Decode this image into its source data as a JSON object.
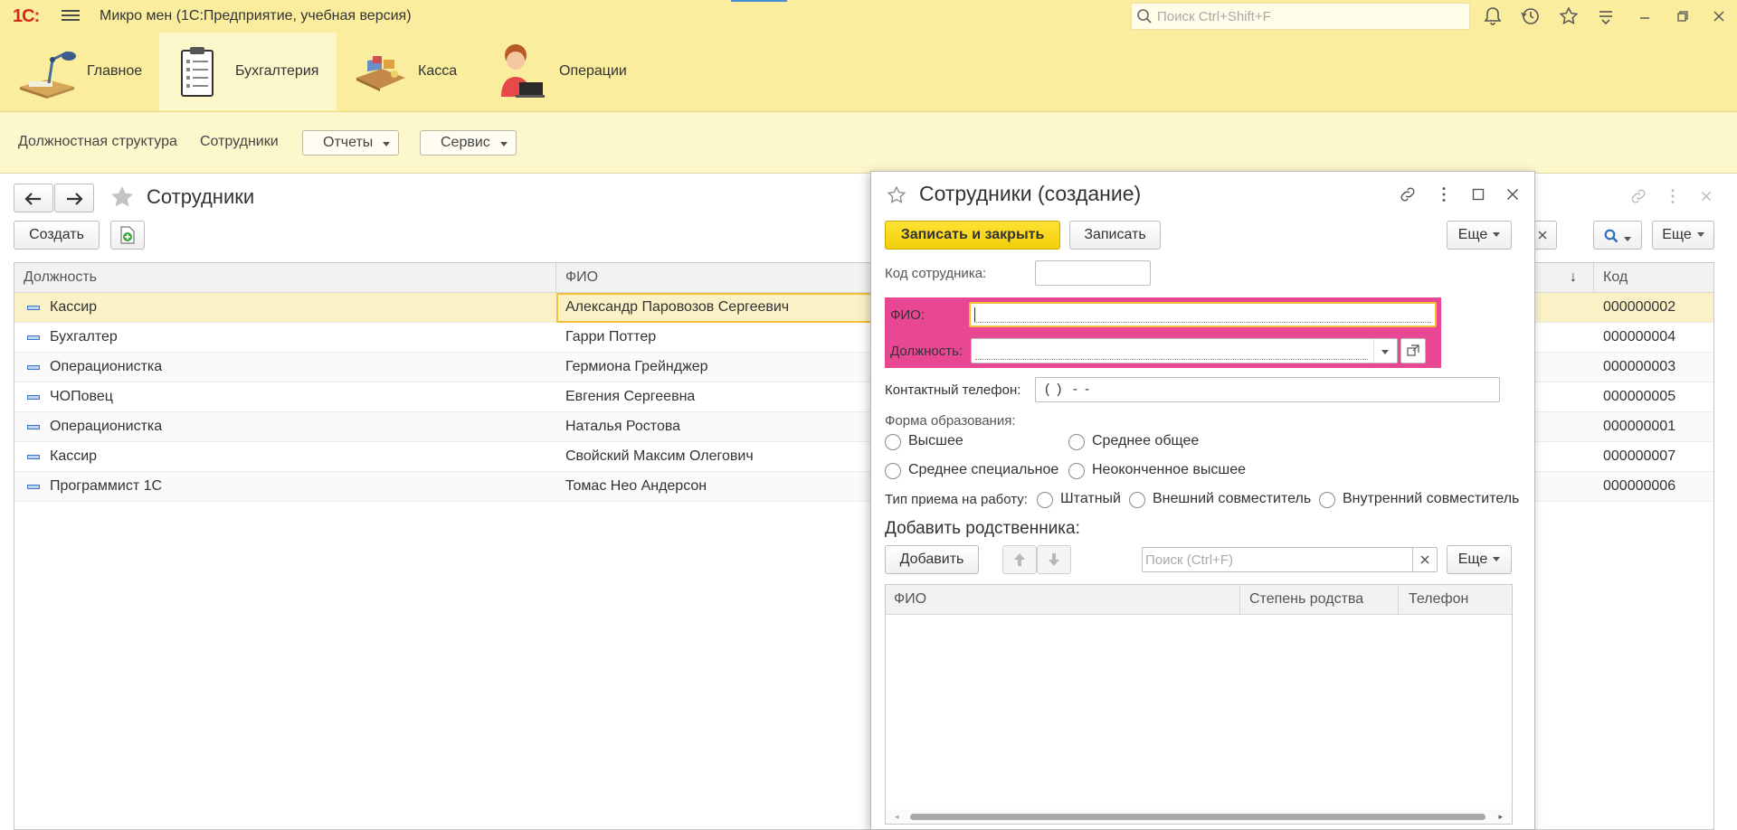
{
  "app": {
    "logo": "1С:",
    "title": "Микро мен  (1С:Предприятие, учебная версия)",
    "search_placeholder": "Поиск Ctrl+Shift+F"
  },
  "sections": [
    {
      "label": "Главное"
    },
    {
      "label": "Бухгалтерия"
    },
    {
      "label": "Касса"
    },
    {
      "label": "Операции"
    }
  ],
  "nav": {
    "links": [
      "Должностная структура",
      "Сотрудники"
    ],
    "reports_label": "Отчеты",
    "service_label": "Сервис"
  },
  "list": {
    "title": "Сотрудники",
    "create_label": "Создать",
    "more_label": "Еще",
    "columns": {
      "position": "Должность",
      "fio": "ФИО",
      "code": "Код",
      "sort_indicator": "↓"
    },
    "rows": [
      {
        "position": "Кассир",
        "fio": "Александр Паровозов Сергеевич",
        "code": "000000002"
      },
      {
        "position": "Бухгалтер",
        "fio": "Гарри Поттер",
        "code": "000000004"
      },
      {
        "position": "Операционистка",
        "fio": "Гермиона Грейнджер",
        "code": "000000003"
      },
      {
        "position": "ЧОПовец",
        "fio": "Евгения Сергеевна",
        "code": "000000005"
      },
      {
        "position": "Операционистка",
        "fio": "Наталья Ростова",
        "code": "000000001"
      },
      {
        "position": "Кассир",
        "fio": "Свойский Максим Олегович",
        "code": "000000007"
      },
      {
        "position": "Программист 1С",
        "fio": "Томас Нео Андерсон",
        "code": "000000006"
      }
    ]
  },
  "dialog": {
    "title": "Сотрудники (создание)",
    "save_close_label": "Записать и закрыть",
    "save_label": "Записать",
    "more_label": "Еще",
    "code_label": "Код сотрудника:",
    "code_value": "",
    "fio_label": "ФИО:",
    "fio_value": "",
    "position_label": "Должность:",
    "position_value": "",
    "phone_label": "Контактный телефон:",
    "phone_value": "(  )   -  -",
    "education_label": "Форма образования:",
    "education_options": [
      "Высшее",
      "Среднее общее",
      "Среднее специальное",
      "Неоконченное высшее"
    ],
    "hire_label": "Тип приема на работу:",
    "hire_options": [
      "Штатный",
      "Внешний совместитель",
      "Внутренний совместитель"
    ],
    "relatives_title": "Добавить родственника:",
    "add_label": "Добавить",
    "search_placeholder": "Поиск (Ctrl+F)",
    "relatives_columns": [
      "ФИО",
      "Степень родства",
      "Телефон"
    ]
  },
  "colors": {
    "accent_yellow": "#fbed9e",
    "primary_button": "#f5d50a",
    "highlight_pink": "#e84893"
  }
}
